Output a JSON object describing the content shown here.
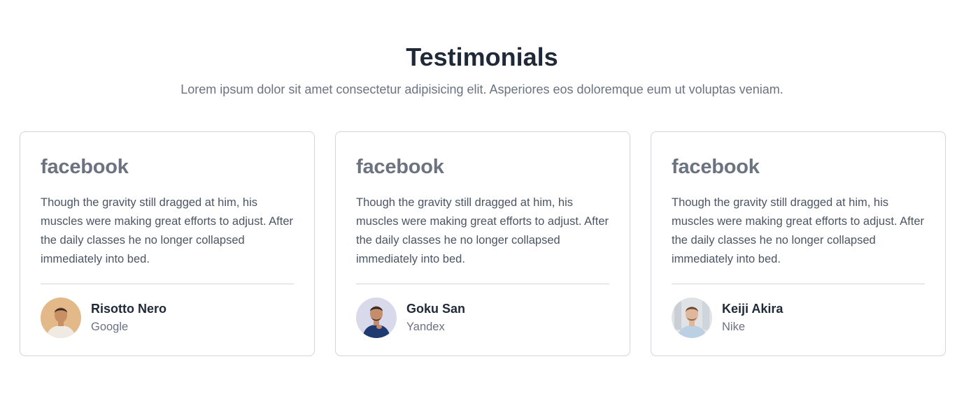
{
  "header": {
    "title": "Testimonials",
    "subtitle": "Lorem ipsum dolor sit amet consectetur adipisicing elit. Asperiores eos doloremque eum ut voluptas veniam."
  },
  "testimonials": [
    {
      "brand": "facebook",
      "quote": "Though the gravity still dragged at him, his muscles were making great efforts to adjust. After the daily classes he no longer collapsed immediately into bed.",
      "name": "Risotto Nero",
      "company": "Google",
      "avatar_icon": "person-photo-1",
      "colors": {
        "bg": "#e3b98a",
        "skin": "#c98f64",
        "hair": "#3b2a20",
        "shirt": "#efeae2"
      }
    },
    {
      "brand": "facebook",
      "quote": "Though the gravity still dragged at him, his muscles were making great efforts to adjust. After the daily classes he no longer collapsed immediately into bed.",
      "name": "Goku San",
      "company": "Yandex",
      "avatar_icon": "person-photo-2",
      "colors": {
        "bg": "#d9d9ec",
        "skin": "#c48d6c",
        "hair": "#2a2320",
        "shirt": "#1f3a70"
      }
    },
    {
      "brand": "facebook",
      "quote": "Though the gravity still dragged at him, his muscles were making great efforts to adjust. After the daily classes he no longer collapsed immediately into bed.",
      "name": "Keiji Akira",
      "company": "Nike",
      "avatar_icon": "person-photo-3",
      "colors": {
        "bg": "#dfe3e6",
        "skin": "#e0b79b",
        "hair": "#6b4a34",
        "shirt": "#bcd0e3"
      }
    }
  ]
}
